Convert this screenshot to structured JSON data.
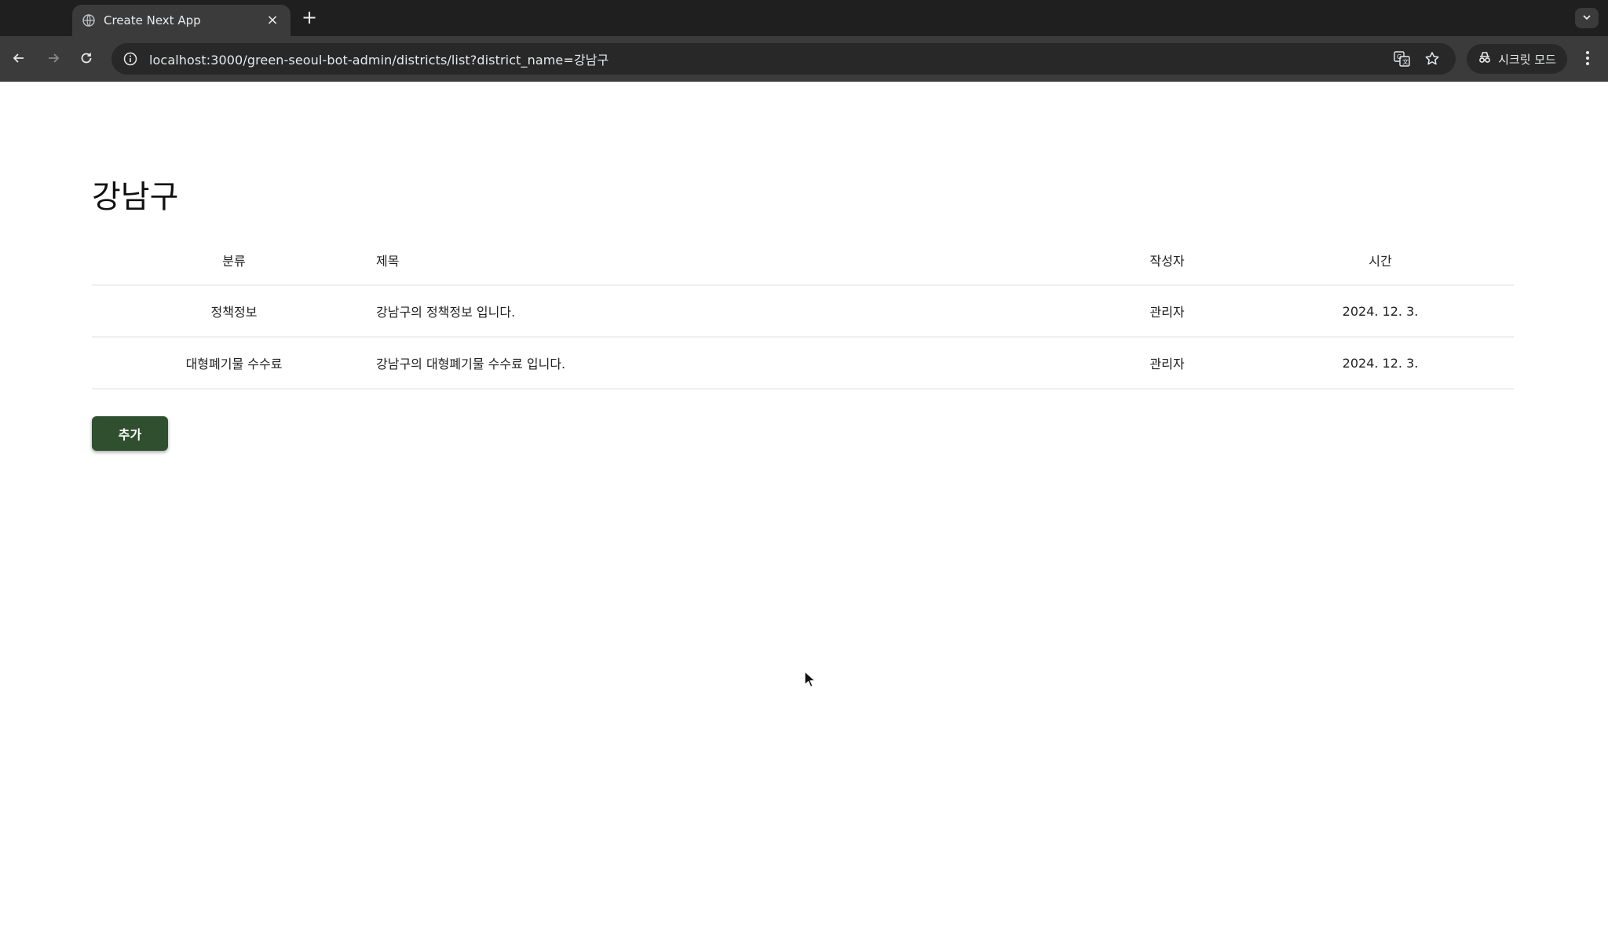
{
  "browser": {
    "tab_title": "Create Next App",
    "tab_close": "×",
    "new_tab": "+",
    "url": "localhost:3000/green-seoul-bot-admin/districts/list?district_name=강남구",
    "incognito_label": "시크릿 모드"
  },
  "page": {
    "title": "강남구",
    "table": {
      "headers": {
        "category": "분류",
        "title": "제목",
        "author": "작성자",
        "time": "시간"
      },
      "rows": [
        {
          "category": "정책정보",
          "title": "강남구의 정책정보 입니다.",
          "author": "관리자",
          "time": "2024. 12. 3."
        },
        {
          "category": "대형폐기물 수수료",
          "title": "강남구의 대형폐기물 수수료 입니다.",
          "author": "관리자",
          "time": "2024. 12. 3."
        }
      ]
    },
    "add_button_label": "추가"
  },
  "colors": {
    "chrome_dark": "#1f1f1f",
    "toolbar": "#3b3b3b",
    "add_button": "#2f4f2f"
  },
  "icons": {
    "favicon": "globe-icon",
    "back": "arrow-left-icon",
    "forward": "arrow-right-icon",
    "reload": "reload-icon",
    "site_info": "info-icon",
    "translate": "translate-icon",
    "bookmark": "star-icon",
    "incognito": "incognito-icon",
    "menu": "kebab-menu-icon",
    "tab_search": "chevron-down-icon",
    "cursor": "mouse-cursor-icon"
  }
}
